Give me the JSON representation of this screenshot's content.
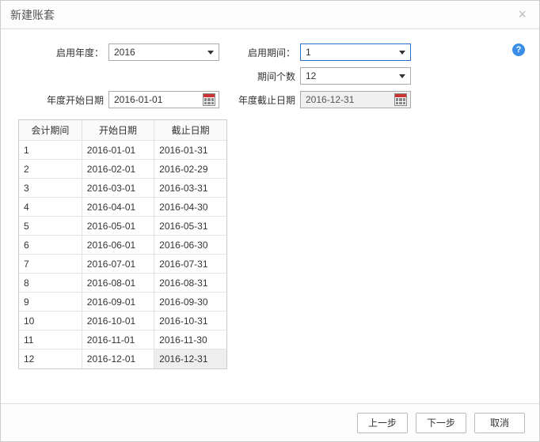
{
  "dialog": {
    "title": "新建账套",
    "help_tooltip": "?"
  },
  "form": {
    "year_label": "启用年度：",
    "year_value": "2016",
    "period_label": "启用期间：",
    "period_value": "1",
    "period_count_label": "期间个数",
    "period_count_value": "12",
    "year_start_label": "年度开始日期",
    "year_start_value": "2016-01-01",
    "year_end_label": "年度截止日期",
    "year_end_value": "2016-12-31"
  },
  "table": {
    "headers": {
      "period": "会计期间",
      "start": "开始日期",
      "end": "截止日期"
    },
    "rows": [
      {
        "period": "1",
        "start": "2016-01-01",
        "end": "2016-01-31"
      },
      {
        "period": "2",
        "start": "2016-02-01",
        "end": "2016-02-29"
      },
      {
        "period": "3",
        "start": "2016-03-01",
        "end": "2016-03-31"
      },
      {
        "period": "4",
        "start": "2016-04-01",
        "end": "2016-04-30"
      },
      {
        "period": "5",
        "start": "2016-05-01",
        "end": "2016-05-31"
      },
      {
        "period": "6",
        "start": "2016-06-01",
        "end": "2016-06-30"
      },
      {
        "period": "7",
        "start": "2016-07-01",
        "end": "2016-07-31"
      },
      {
        "period": "8",
        "start": "2016-08-01",
        "end": "2016-08-31"
      },
      {
        "period": "9",
        "start": "2016-09-01",
        "end": "2016-09-30"
      },
      {
        "period": "10",
        "start": "2016-10-01",
        "end": "2016-10-31"
      },
      {
        "period": "11",
        "start": "2016-11-01",
        "end": "2016-11-30"
      },
      {
        "period": "12",
        "start": "2016-12-01",
        "end": "2016-12-31"
      }
    ]
  },
  "footer": {
    "prev": "上一步",
    "next": "下一步",
    "cancel": "取消"
  }
}
